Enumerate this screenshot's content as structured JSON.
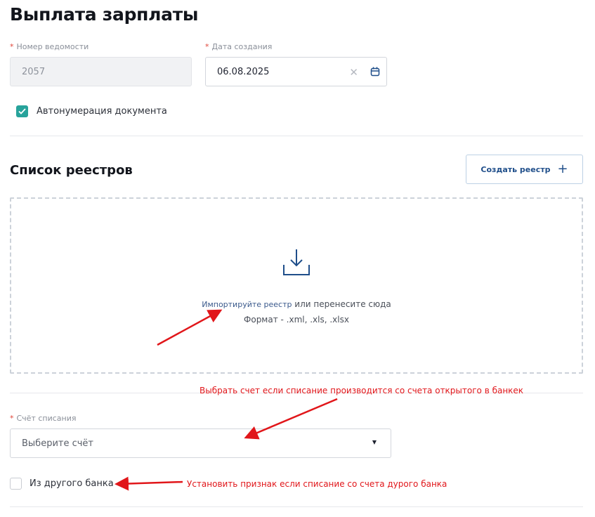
{
  "page": {
    "title": "Выплата зарплаты"
  },
  "form": {
    "number": {
      "required_mark": "*",
      "label": "Номер ведомости",
      "value": "2057"
    },
    "date": {
      "required_mark": "*",
      "label": "Дата создания",
      "value": "06.08.2025",
      "clear_icon": "close-icon",
      "calendar_icon": "calendar-icon"
    },
    "autonumber": {
      "label": "Автонумерация документа",
      "checked": true
    }
  },
  "registers": {
    "title": "Список реестров",
    "create_button": {
      "label": "Создать реестр",
      "icon": "plus-icon"
    },
    "dropzone": {
      "icon": "download-icon",
      "link_text": "Импортируйте реестр",
      "text_after_link": " или перенесите сюда",
      "formats": "Формат - .xml, .xls, .xlsx"
    }
  },
  "account": {
    "required_mark": "*",
    "label": "Счёт списания",
    "placeholder": "Выберите счёт",
    "caret": "▼"
  },
  "other_bank": {
    "label": "Из другого банка",
    "checked": false
  },
  "annotations": {
    "account_note": "Выбрать счет если списание производится со счета открытого в банкек",
    "other_bank_note": "Установить признак если списание со счета дурого банка"
  },
  "colors": {
    "accent_teal": "#27a39b",
    "primary_blue": "#1f4e8a",
    "annotation_red": "#e1161a",
    "required_red": "#e0463a"
  }
}
